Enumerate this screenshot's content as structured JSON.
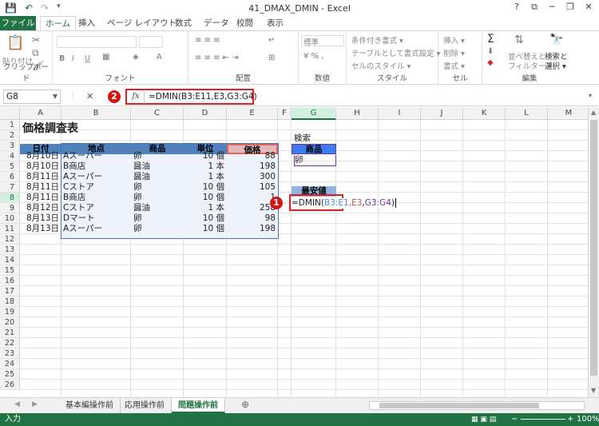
{
  "window": {
    "title": "41_DMAX_DMIN - Excel",
    "help": "?",
    "minimize": "─",
    "restore": "❐",
    "close": "✕",
    "ribbon_opts": "⧉"
  },
  "qat": {
    "save": "💾",
    "undo": "↶",
    "redo": "↷",
    "customize": "▾"
  },
  "tabs": [
    {
      "label": "ファイル"
    },
    {
      "label": "ホーム"
    },
    {
      "label": "挿入"
    },
    {
      "label": "ページ レイアウト"
    },
    {
      "label": "数式"
    },
    {
      "label": "データ"
    },
    {
      "label": "校閲"
    },
    {
      "label": "表示"
    }
  ],
  "ribbon": {
    "clipboard": {
      "label": "クリップボード",
      "paste": "貼り付け"
    },
    "font": {
      "label": "フォント",
      "bold": "B",
      "italic": "I",
      "underline": "U"
    },
    "alignment": {
      "label": "配置"
    },
    "number": {
      "label": "数値",
      "format": "標準"
    },
    "styles": {
      "label": "スタイル",
      "conditional": "条件付き書式 ▾",
      "table": "テーブルとして書式設定 ▾",
      "cell": "セルのスタイル ▾"
    },
    "cells": {
      "label": "セル",
      "insert": "挿入 ▾",
      "delete": "削除 ▾",
      "format": "書式 ▾"
    },
    "editing": {
      "label": "編集",
      "sort": "並べ替えと",
      "filter": "フィルター ▾",
      "find": "検索と",
      "select": "選択 ▾"
    }
  },
  "formula_bar": {
    "name_box": "G8",
    "cancel": "✕",
    "fx": "fx",
    "formula": "=DMIN(B3:E11,E3,G3:G4)"
  },
  "callouts": {
    "one": "1",
    "two": "2"
  },
  "columns": [
    "A",
    "B",
    "C",
    "D",
    "E",
    "F",
    "G",
    "H",
    "I",
    "J",
    "K",
    "L",
    "M"
  ],
  "rows": [
    "1",
    "2",
    "3",
    "4",
    "5",
    "6",
    "7",
    "8",
    "9",
    "10",
    "11",
    "12",
    "13",
    "14",
    "15",
    "16",
    "17",
    "18",
    "19",
    "20",
    "21",
    "22",
    "23",
    "24",
    "25",
    "26"
  ],
  "sheet": {
    "title": "価格調査表",
    "headers": [
      "日付",
      "地点",
      "商品",
      "単位",
      "価格"
    ],
    "data": [
      [
        "8月10日",
        "Aスーパー",
        "卵",
        "10 個",
        "88"
      ],
      [
        "8月10日",
        "B商店",
        "醤油",
        "1 本",
        "198"
      ],
      [
        "8月11日",
        "Aスーパー",
        "醤油",
        "1 本",
        "300"
      ],
      [
        "8月11日",
        "Cストア",
        "卵",
        "10 個",
        "105"
      ],
      [
        "8月11日",
        "B商店",
        "卵",
        "10 個",
        "1"
      ],
      [
        "8月12日",
        "Cストア",
        "醤油",
        "1 本",
        "258"
      ],
      [
        "8月13日",
        "Dマート",
        "卵",
        "10 個",
        "98"
      ],
      [
        "8月13日",
        "Aスーパー",
        "卵",
        "10 個",
        "198"
      ]
    ],
    "search_label": "検索",
    "criteria_header": "商品",
    "criteria_value": "卵",
    "min_label": "最安値",
    "edit_prefix": "=DMIN(",
    "edit_range": "B3:E1",
    "edit_field": ",E3",
    "edit_sep": ",",
    "edit_criteria": "G3:G4",
    "edit_close": ")"
  },
  "sheet_tabs": [
    "基本編操作前",
    "応用操作前",
    "問題操作前"
  ],
  "status": {
    "mode": "入力",
    "zoom": "100%"
  },
  "colors": {
    "excel_green": "#217346",
    "header_blue": "#4f81bd",
    "callout_red": "#d21414"
  }
}
